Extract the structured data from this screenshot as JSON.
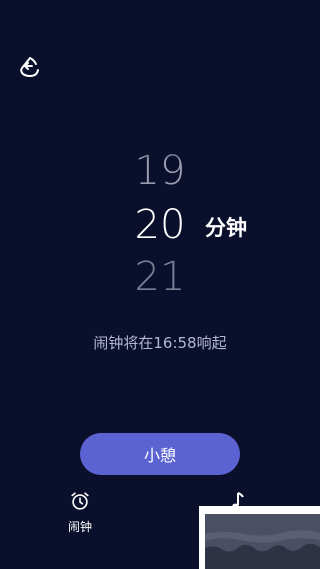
{
  "picker": {
    "prev": "19",
    "current": "20",
    "next": "21",
    "unit": "分钟"
  },
  "ring_info": "闹钟将在16:58响起",
  "snooze_label": "小憩",
  "tabs": {
    "alarm_label": "闹钟"
  },
  "icons": {
    "back": "back-arrow-icon",
    "alarm": "alarm-clock-icon",
    "music": "music-note-icon"
  },
  "colors": {
    "background": "#0a0f2c",
    "accent": "#5b63d3",
    "text_secondary": "#b3b7d0"
  }
}
